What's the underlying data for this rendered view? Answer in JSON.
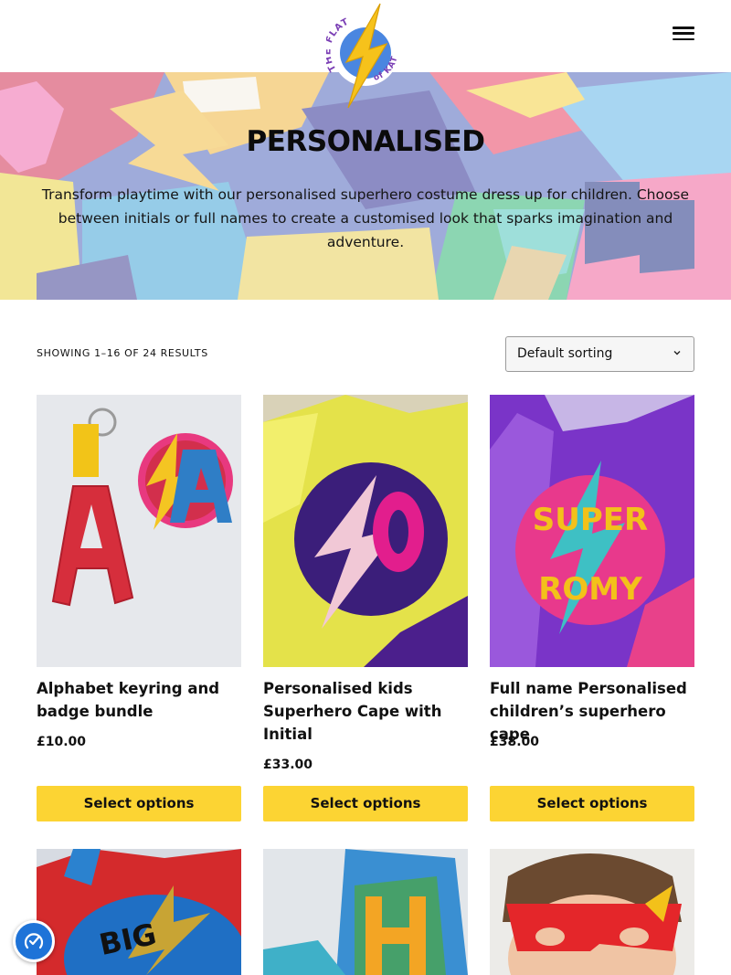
{
  "header": {
    "logo": {
      "text_top": "THE FLAT",
      "text_bottom": "of KAT",
      "icon": "lightning-bolt-icon"
    },
    "menu_icon": "hamburger-menu-icon"
  },
  "hero": {
    "title": "PERSONALISED",
    "description": "Transform playtime with our personalised superhero costume dress up for children. Choose between initials or full names to create a customised look that sparks imagination and adventure."
  },
  "shop": {
    "result_count": "SHOWING 1–16 OF 24 RESULTS",
    "sort": {
      "selected": "Default sorting",
      "icon": "chevron-down-icon"
    },
    "button_color": "#fcd433",
    "products": [
      {
        "name": "Alphabet keyring and badge bundle",
        "price": "£10.00",
        "button": "Select options",
        "image_letters": [
          "A",
          "A"
        ]
      },
      {
        "name": "Personalised kids Superhero Cape with Initial",
        "price": "£33.00",
        "button": "Select options",
        "image_letters": [
          "O"
        ]
      },
      {
        "name": "Full name Personalised children’s superhero cape",
        "price": "£38.00",
        "button": "Select options",
        "image_letters": [
          "SUPER",
          "ROMY"
        ]
      }
    ],
    "row2_images": [
      {
        "image_letters": [
          "BIG"
        ]
      },
      {
        "image_letters": [
          "H"
        ]
      },
      {
        "image_letters": []
      }
    ]
  },
  "accessibility_widget": {
    "icon": "accessibility-gauge-icon",
    "color": "#1e73d8"
  }
}
